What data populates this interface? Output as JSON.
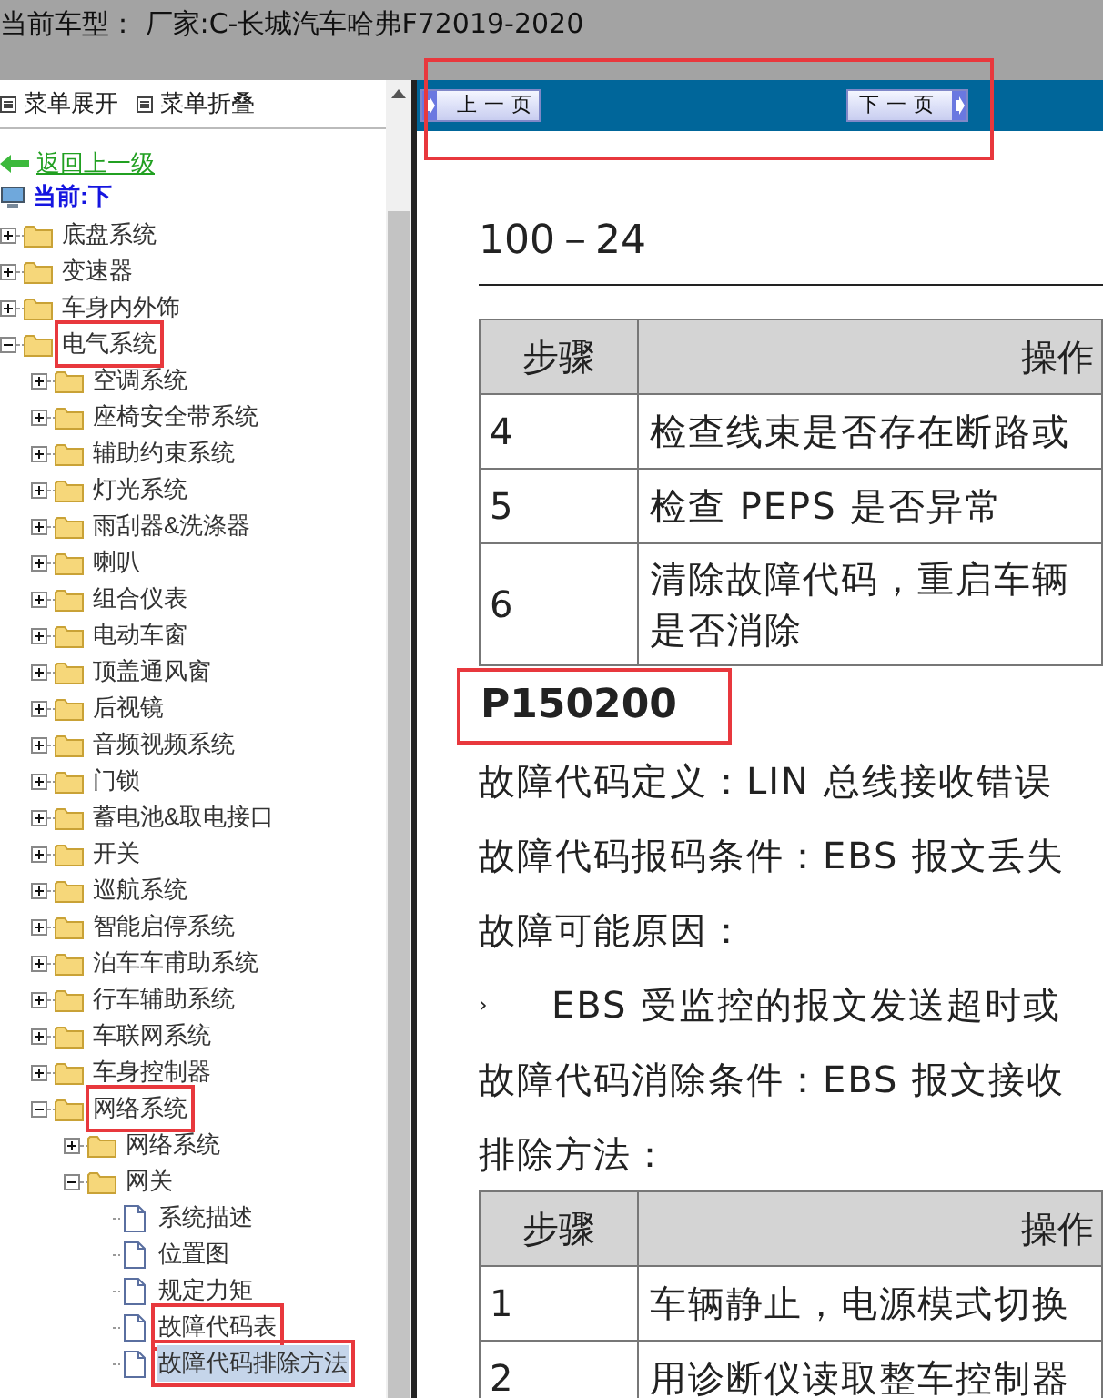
{
  "header": {
    "title": "当前车型： 厂家:C-长城汽车哈弗F72019-2020"
  },
  "sidebar": {
    "menu_controls": [
      "菜单展开",
      "菜单折叠"
    ],
    "back_link": "返回上一级",
    "current": "当前:下",
    "tree": [
      {
        "label": "底盘系统",
        "kind": "folder",
        "expanded": false,
        "selected": false,
        "highlighted": false
      },
      {
        "label": "变速器",
        "kind": "folder",
        "expanded": false,
        "selected": false,
        "highlighted": false
      },
      {
        "label": "车身内外饰",
        "kind": "folder",
        "expanded": false,
        "selected": false,
        "highlighted": false
      },
      {
        "label": "电气系统",
        "kind": "folder",
        "expanded": true,
        "selected": false,
        "highlighted": true,
        "children": [
          {
            "label": "空调系统",
            "kind": "folder",
            "expanded": false,
            "selected": false,
            "highlighted": false
          },
          {
            "label": "座椅安全带系统",
            "kind": "folder",
            "expanded": false,
            "selected": false,
            "highlighted": false
          },
          {
            "label": "辅助约束系统",
            "kind": "folder",
            "expanded": false,
            "selected": false,
            "highlighted": false
          },
          {
            "label": "灯光系统",
            "kind": "folder",
            "expanded": false,
            "selected": false,
            "highlighted": false
          },
          {
            "label": "雨刮器&洗涤器",
            "kind": "folder",
            "expanded": false,
            "selected": false,
            "highlighted": false
          },
          {
            "label": "喇叭",
            "kind": "folder",
            "expanded": false,
            "selected": false,
            "highlighted": false
          },
          {
            "label": "组合仪表",
            "kind": "folder",
            "expanded": false,
            "selected": false,
            "highlighted": false
          },
          {
            "label": "电动车窗",
            "kind": "folder",
            "expanded": false,
            "selected": false,
            "highlighted": false
          },
          {
            "label": "顶盖通风窗",
            "kind": "folder",
            "expanded": false,
            "selected": false,
            "highlighted": false
          },
          {
            "label": "后视镜",
            "kind": "folder",
            "expanded": false,
            "selected": false,
            "highlighted": false
          },
          {
            "label": "音频视频系统",
            "kind": "folder",
            "expanded": false,
            "selected": false,
            "highlighted": false
          },
          {
            "label": "门锁",
            "kind": "folder",
            "expanded": false,
            "selected": false,
            "highlighted": false
          },
          {
            "label": "蓄电池&取电接口",
            "kind": "folder",
            "expanded": false,
            "selected": false,
            "highlighted": false
          },
          {
            "label": "开关",
            "kind": "folder",
            "expanded": false,
            "selected": false,
            "highlighted": false
          },
          {
            "label": "巡航系统",
            "kind": "folder",
            "expanded": false,
            "selected": false,
            "highlighted": false
          },
          {
            "label": "智能启停系统",
            "kind": "folder",
            "expanded": false,
            "selected": false,
            "highlighted": false
          },
          {
            "label": "泊车车甫助系统",
            "kind": "folder",
            "expanded": false,
            "selected": false,
            "highlighted": false
          },
          {
            "label": "行车辅助系统",
            "kind": "folder",
            "expanded": false,
            "selected": false,
            "highlighted": false
          },
          {
            "label": "车联网系统",
            "kind": "folder",
            "expanded": false,
            "selected": false,
            "highlighted": false
          },
          {
            "label": "车身控制器",
            "kind": "folder",
            "expanded": false,
            "selected": false,
            "highlighted": false
          },
          {
            "label": "网络系统",
            "kind": "folder",
            "expanded": true,
            "selected": false,
            "highlighted": true,
            "children": [
              {
                "label": "网络系统",
                "kind": "folder",
                "expanded": false,
                "selected": false,
                "highlighted": false
              },
              {
                "label": "网关",
                "kind": "folder",
                "expanded": true,
                "selected": false,
                "highlighted": false,
                "children": [
                  {
                    "label": "系统描述",
                    "kind": "document",
                    "selected": false,
                    "highlighted": false
                  },
                  {
                    "label": "位置图",
                    "kind": "document",
                    "selected": false,
                    "highlighted": false
                  },
                  {
                    "label": "规定力矩",
                    "kind": "document",
                    "selected": false,
                    "highlighted": false
                  },
                  {
                    "label": "故障代码表",
                    "kind": "document",
                    "selected": false,
                    "highlighted": true
                  },
                  {
                    "label": "故障代码排除方法",
                    "kind": "document",
                    "selected": true,
                    "highlighted": true
                  }
                ]
              }
            ]
          }
        ]
      }
    ]
  },
  "navigation": {
    "highlighted": true,
    "previous": "上一页",
    "next": "下一页"
  },
  "document": {
    "page_number": "100－24",
    "table_1": {
      "columns": [
        "步骤",
        "操作"
      ],
      "rows": [
        [
          "4",
          "检查线束是否存在断路或"
        ],
        [
          "5",
          "检查 PEPS 是否异常"
        ],
        [
          "6",
          "清除故障代码，重启车辆是否消除"
        ]
      ]
    },
    "fault_code": {
      "text": "P150200",
      "highlighted": true
    },
    "paragraphs": [
      {
        "kind": "text",
        "text": "故障代码定义：LIN 总线接收错误"
      },
      {
        "kind": "text",
        "text": "故障代码报码条件：EBS 报文丢失"
      },
      {
        "kind": "text",
        "text": "故障可能原因："
      },
      {
        "kind": "bullet",
        "marker": "›",
        "text": "EBS 受监控的报文发送超时或"
      },
      {
        "kind": "text",
        "text": "故障代码消除条件：EBS 报文接收"
      },
      {
        "kind": "text",
        "text": "排除方法："
      }
    ],
    "table_2": {
      "columns": [
        "步骤",
        "操作"
      ],
      "rows": [
        [
          "1",
          "车辆静止，电源模式切换"
        ],
        [
          "2",
          "用诊断仪读取整车控制器"
        ]
      ]
    }
  }
}
